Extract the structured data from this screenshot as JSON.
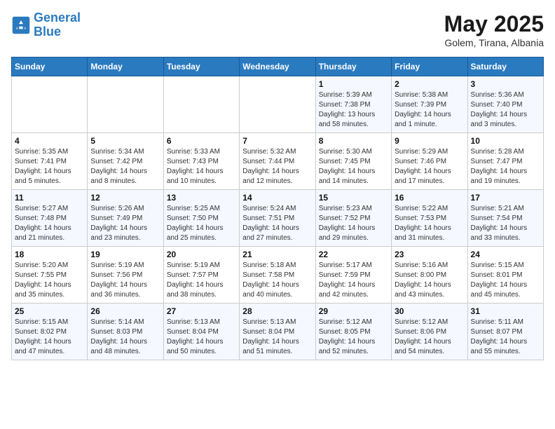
{
  "header": {
    "logo_line1": "General",
    "logo_line2": "Blue",
    "title": "May 2025",
    "subtitle": "Golem, Tirana, Albania"
  },
  "weekdays": [
    "Sunday",
    "Monday",
    "Tuesday",
    "Wednesday",
    "Thursday",
    "Friday",
    "Saturday"
  ],
  "weeks": [
    [
      {
        "day": "",
        "info": ""
      },
      {
        "day": "",
        "info": ""
      },
      {
        "day": "",
        "info": ""
      },
      {
        "day": "",
        "info": ""
      },
      {
        "day": "1",
        "info": "Sunrise: 5:39 AM\nSunset: 7:38 PM\nDaylight: 13 hours and 58 minutes."
      },
      {
        "day": "2",
        "info": "Sunrise: 5:38 AM\nSunset: 7:39 PM\nDaylight: 14 hours and 1 minute."
      },
      {
        "day": "3",
        "info": "Sunrise: 5:36 AM\nSunset: 7:40 PM\nDaylight: 14 hours and 3 minutes."
      }
    ],
    [
      {
        "day": "4",
        "info": "Sunrise: 5:35 AM\nSunset: 7:41 PM\nDaylight: 14 hours and 5 minutes."
      },
      {
        "day": "5",
        "info": "Sunrise: 5:34 AM\nSunset: 7:42 PM\nDaylight: 14 hours and 8 minutes."
      },
      {
        "day": "6",
        "info": "Sunrise: 5:33 AM\nSunset: 7:43 PM\nDaylight: 14 hours and 10 minutes."
      },
      {
        "day": "7",
        "info": "Sunrise: 5:32 AM\nSunset: 7:44 PM\nDaylight: 14 hours and 12 minutes."
      },
      {
        "day": "8",
        "info": "Sunrise: 5:30 AM\nSunset: 7:45 PM\nDaylight: 14 hours and 14 minutes."
      },
      {
        "day": "9",
        "info": "Sunrise: 5:29 AM\nSunset: 7:46 PM\nDaylight: 14 hours and 17 minutes."
      },
      {
        "day": "10",
        "info": "Sunrise: 5:28 AM\nSunset: 7:47 PM\nDaylight: 14 hours and 19 minutes."
      }
    ],
    [
      {
        "day": "11",
        "info": "Sunrise: 5:27 AM\nSunset: 7:48 PM\nDaylight: 14 hours and 21 minutes."
      },
      {
        "day": "12",
        "info": "Sunrise: 5:26 AM\nSunset: 7:49 PM\nDaylight: 14 hours and 23 minutes."
      },
      {
        "day": "13",
        "info": "Sunrise: 5:25 AM\nSunset: 7:50 PM\nDaylight: 14 hours and 25 minutes."
      },
      {
        "day": "14",
        "info": "Sunrise: 5:24 AM\nSunset: 7:51 PM\nDaylight: 14 hours and 27 minutes."
      },
      {
        "day": "15",
        "info": "Sunrise: 5:23 AM\nSunset: 7:52 PM\nDaylight: 14 hours and 29 minutes."
      },
      {
        "day": "16",
        "info": "Sunrise: 5:22 AM\nSunset: 7:53 PM\nDaylight: 14 hours and 31 minutes."
      },
      {
        "day": "17",
        "info": "Sunrise: 5:21 AM\nSunset: 7:54 PM\nDaylight: 14 hours and 33 minutes."
      }
    ],
    [
      {
        "day": "18",
        "info": "Sunrise: 5:20 AM\nSunset: 7:55 PM\nDaylight: 14 hours and 35 minutes."
      },
      {
        "day": "19",
        "info": "Sunrise: 5:19 AM\nSunset: 7:56 PM\nDaylight: 14 hours and 36 minutes."
      },
      {
        "day": "20",
        "info": "Sunrise: 5:19 AM\nSunset: 7:57 PM\nDaylight: 14 hours and 38 minutes."
      },
      {
        "day": "21",
        "info": "Sunrise: 5:18 AM\nSunset: 7:58 PM\nDaylight: 14 hours and 40 minutes."
      },
      {
        "day": "22",
        "info": "Sunrise: 5:17 AM\nSunset: 7:59 PM\nDaylight: 14 hours and 42 minutes."
      },
      {
        "day": "23",
        "info": "Sunrise: 5:16 AM\nSunset: 8:00 PM\nDaylight: 14 hours and 43 minutes."
      },
      {
        "day": "24",
        "info": "Sunrise: 5:15 AM\nSunset: 8:01 PM\nDaylight: 14 hours and 45 minutes."
      }
    ],
    [
      {
        "day": "25",
        "info": "Sunrise: 5:15 AM\nSunset: 8:02 PM\nDaylight: 14 hours and 47 minutes."
      },
      {
        "day": "26",
        "info": "Sunrise: 5:14 AM\nSunset: 8:03 PM\nDaylight: 14 hours and 48 minutes."
      },
      {
        "day": "27",
        "info": "Sunrise: 5:13 AM\nSunset: 8:04 PM\nDaylight: 14 hours and 50 minutes."
      },
      {
        "day": "28",
        "info": "Sunrise: 5:13 AM\nSunset: 8:04 PM\nDaylight: 14 hours and 51 minutes."
      },
      {
        "day": "29",
        "info": "Sunrise: 5:12 AM\nSunset: 8:05 PM\nDaylight: 14 hours and 52 minutes."
      },
      {
        "day": "30",
        "info": "Sunrise: 5:12 AM\nSunset: 8:06 PM\nDaylight: 14 hours and 54 minutes."
      },
      {
        "day": "31",
        "info": "Sunrise: 5:11 AM\nSunset: 8:07 PM\nDaylight: 14 hours and 55 minutes."
      }
    ]
  ]
}
